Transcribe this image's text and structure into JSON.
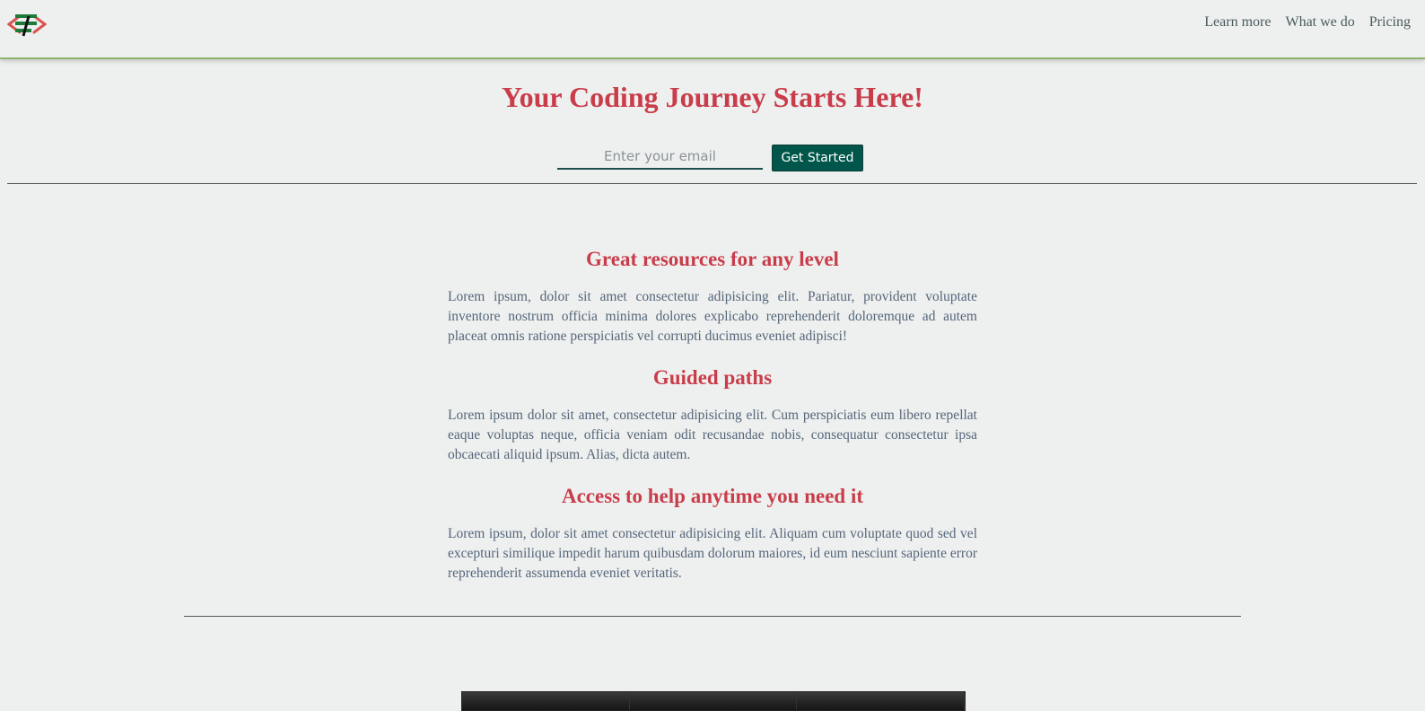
{
  "header": {
    "logo_label": "site-logo",
    "nav": [
      {
        "label": "Learn more"
      },
      {
        "label": "What we do"
      },
      {
        "label": "Pricing"
      }
    ]
  },
  "hero": {
    "title": "Your Coding Journey Starts Here!",
    "email_placeholder": "Enter your email",
    "email_value": "",
    "cta_label": "Get Started"
  },
  "features": [
    {
      "title": "Great resources for any level",
      "text": "Lorem ipsum, dolor sit amet consectetur adipisicing elit. Pariatur, provident voluptate inventore nostrum officia minima dolores explicabo reprehenderit doloremque ad autem placeat omnis ratione perspiciatis vel corrupti ducimus eveniet adipisci!"
    },
    {
      "title": "Guided paths",
      "text": "Lorem ipsum dolor sit amet, consectetur adipisicing elit. Cum perspiciatis eum libero repellat eaque voluptas neque, officia veniam odit recusandae nobis, consequatur consectetur ipsa obcaecati aliquid ipsum. Alias, dicta autem."
    },
    {
      "title": "Access to help anytime you need it",
      "text": "Lorem ipsum, dolor sit amet consectetur adipisicing elit. Aliquam cum voluptate quod sed vel excepturi similique impedit harum quibusdam dolorum maiores, id eum nesciunt sapiente error reprehenderit assumenda eveniet veritatis."
    }
  ],
  "colors": {
    "accent": "#c93d4b",
    "button": "#00564a",
    "header_border": "#8fb36a",
    "background": "#eef0ef"
  },
  "icons": {
    "logo": "code-logo-icon"
  }
}
